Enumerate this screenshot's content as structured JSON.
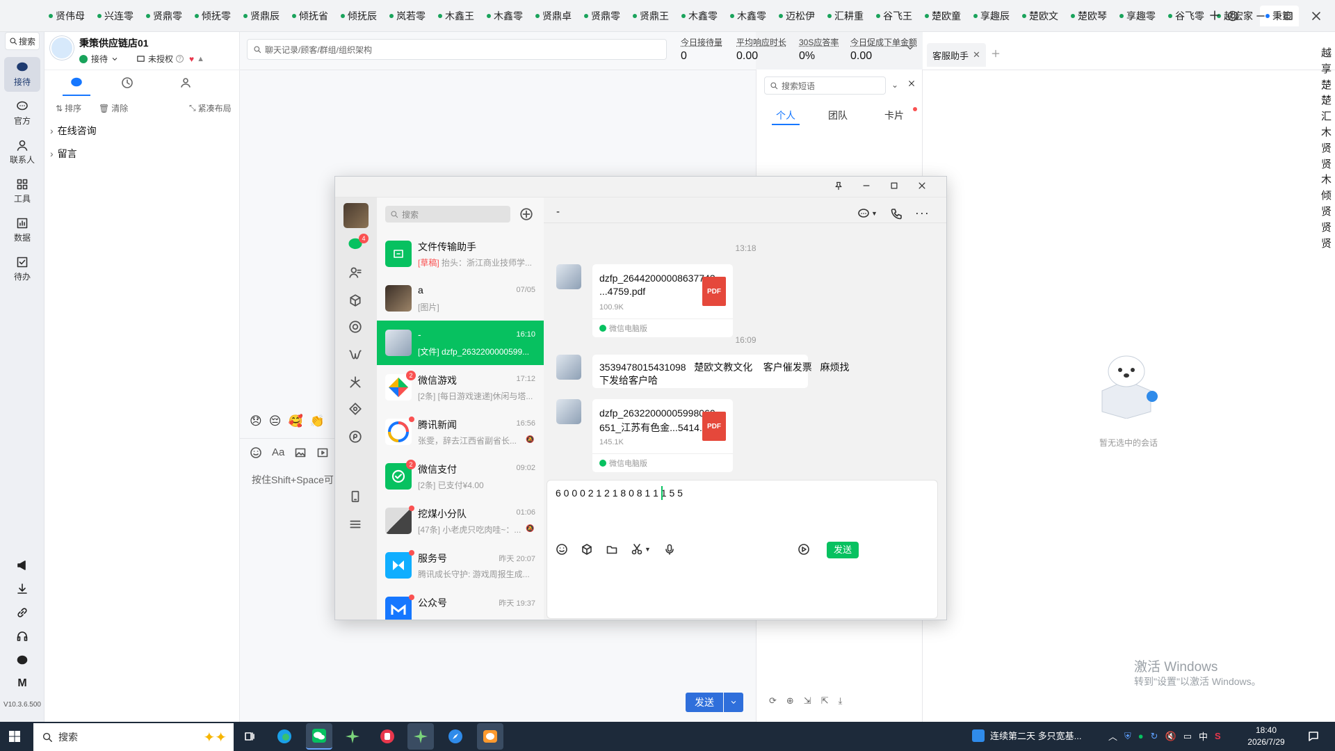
{
  "tabs": [
    "贤伟母",
    "兴连零",
    "贤鼎零",
    "倾抚零",
    "贤鼎辰",
    "倾抚省",
    "倾抚辰",
    "岚若零",
    "木鑫王",
    "木鑫零",
    "贤鼎卓",
    "贤鼎零",
    "贤鼎王",
    "木鑫零",
    "木鑫零",
    "迈松伊",
    "汇耕重",
    "谷飞王",
    "楚欧童",
    "享趣辰",
    "楚欧文",
    "楚欧琴",
    "享趣零",
    "谷飞零",
    "越宏家",
    "秉策"
  ],
  "rail": {
    "search": "搜索",
    "items": [
      "接待",
      "官方",
      "联系人",
      "工具",
      "数据",
      "待办"
    ],
    "version": "V10.3.6.500"
  },
  "shop": {
    "name": "秉策供应链店01",
    "status": "接待",
    "auth": "未授权"
  },
  "left": {
    "sort": "排序",
    "clear": "清除",
    "layout": "紧凑布局",
    "groups": [
      "在线咨询",
      "留言"
    ]
  },
  "center": {
    "search_placeholder": "聊天记录/顾客/群组/组织架构",
    "input_hint": "按住Shift+Space可",
    "send": "发送"
  },
  "stats": [
    {
      "label": "今日接待量",
      "value": "0"
    },
    {
      "label": "平均响应时长",
      "value": "0.00"
    },
    {
      "label": "30S应答率",
      "value": "0%"
    },
    {
      "label": "今日促成下单金额",
      "value": "0.00"
    }
  ],
  "kb": {
    "search_placeholder": "搜索短语",
    "tabs": [
      "个人",
      "团队",
      "卡片"
    ]
  },
  "right": {
    "tab": "客服助手",
    "empty": "暂无选中的会话",
    "activate_title": "激活 Windows",
    "activate_sub": "转到\"设置\"以激活 Windows。",
    "edge_chars": [
      "越",
      "享",
      "楚",
      "楚",
      "汇",
      "木",
      "贤",
      "贤",
      "木",
      "倾",
      "贤",
      "贤",
      "贤"
    ]
  },
  "wechat": {
    "search_placeholder": "搜索",
    "unread": "4",
    "conversations": [
      {
        "name": "文件传输助手",
        "time": "",
        "draft": "[草稿]",
        "preview": " 抬头：浙江商业技师学..."
      },
      {
        "name": "a",
        "time": "07/05",
        "preview": "[图片]"
      },
      {
        "name": "-",
        "time": "16:10",
        "preview": "[文件] dzfp_2632200000599..."
      },
      {
        "name": "微信游戏",
        "time": "17:12",
        "preview": "[2条] [每日游戏速递]休闲与塔...",
        "badge": "2"
      },
      {
        "name": "腾讯新闻",
        "time": "16:56",
        "preview": "张雯，辞去江西省副省长..."
      },
      {
        "name": "微信支付",
        "time": "09:02",
        "preview": "[2条] 已支付¥4.00",
        "badge": "2"
      },
      {
        "name": "挖煤小分队",
        "time": "01:06",
        "preview": "[47条] 小老虎只吃肉哇~：..."
      },
      {
        "name": "服务号",
        "time": "昨天 20:07",
        "preview": "腾讯成长守护: 游戏周报生成..."
      },
      {
        "name": "公众号",
        "time": "昨天 19:37",
        "preview": ""
      }
    ],
    "chat_title": "-",
    "msgs": {
      "t1": "13:18",
      "f1_name_1": "dzfp_26442000008637743",
      "f1_name_2": "...4759.pdf",
      "f1_size": "100.9K",
      "f1_src": "微信电脑版",
      "t2": "16:09",
      "text_1": "3539478015431098   楚欧文教文化    客户催发票   麻烦找",
      "text_2": "下发给客户哈",
      "f2_name_1": "dzfp_26322000005998060",
      "f2_name_2": "651_江苏有色金...5414.pdf",
      "f2_size": "145.1K",
      "f2_src": "微信电脑版",
      "pdf": "PDF"
    },
    "input": "6 0 0 0 2 1 2 1 8 0 8 1 1 1 5 5",
    "send": "发送"
  },
  "taskbar": {
    "search": "搜索",
    "news": "连续第二天 多只宽基...",
    "ime": "中",
    "time": "18:40",
    "date": "2026/7/29"
  },
  "colors": {
    "wechat_green": "#07c160",
    "brand_blue": "#1677ff",
    "badge_red": "#fa5151"
  }
}
